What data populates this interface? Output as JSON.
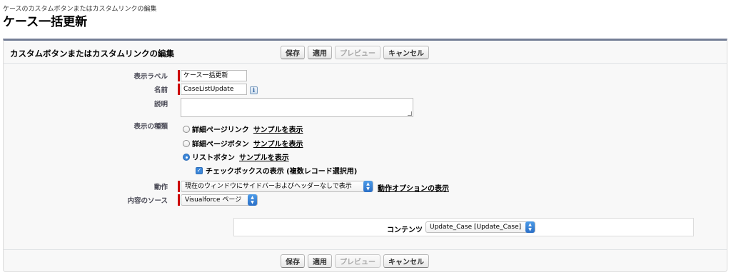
{
  "header": {
    "breadcrumb": "ケースのカスタムボタンまたはカスタムリンクの編集",
    "title": "ケース一括更新"
  },
  "section": {
    "title": "カスタムボタンまたはカスタムリンクの編集"
  },
  "buttons": {
    "save": "保存",
    "apply": "適用",
    "preview": "プレビュー",
    "cancel": "キャンセル"
  },
  "form": {
    "label_label": "表示ラベル",
    "label_value": "ケース一括更新",
    "name_label": "名前",
    "name_value": "CaseListUpdate",
    "description_label": "説明",
    "description_value": "",
    "display_type_label": "表示の種類",
    "display_types": [
      {
        "label": "詳細ページリンク",
        "link": "サンプルを表示",
        "selected": false
      },
      {
        "label": "詳細ページボタン",
        "link": "サンプルを表示",
        "selected": false
      },
      {
        "label": "リストボタン",
        "link": "サンプルを表示",
        "selected": true
      }
    ],
    "checkbox_label": "チェックボックスの表示 (複数レコード選択用)",
    "checkbox_checked": true,
    "behavior_label": "動作",
    "behavior_value": "現在のウィンドウにサイドバーおよびヘッダーなしで表示",
    "behavior_link": "動作オプションの表示",
    "source_label": "内容のソース",
    "source_value": "Visualforce ページ",
    "content_label": "コンテンツ",
    "content_value": "Update_Case [Update_Case]"
  },
  "colors": {
    "accent": "#747e96",
    "required": "#cc0000",
    "select_blue": "#3b86d8"
  }
}
